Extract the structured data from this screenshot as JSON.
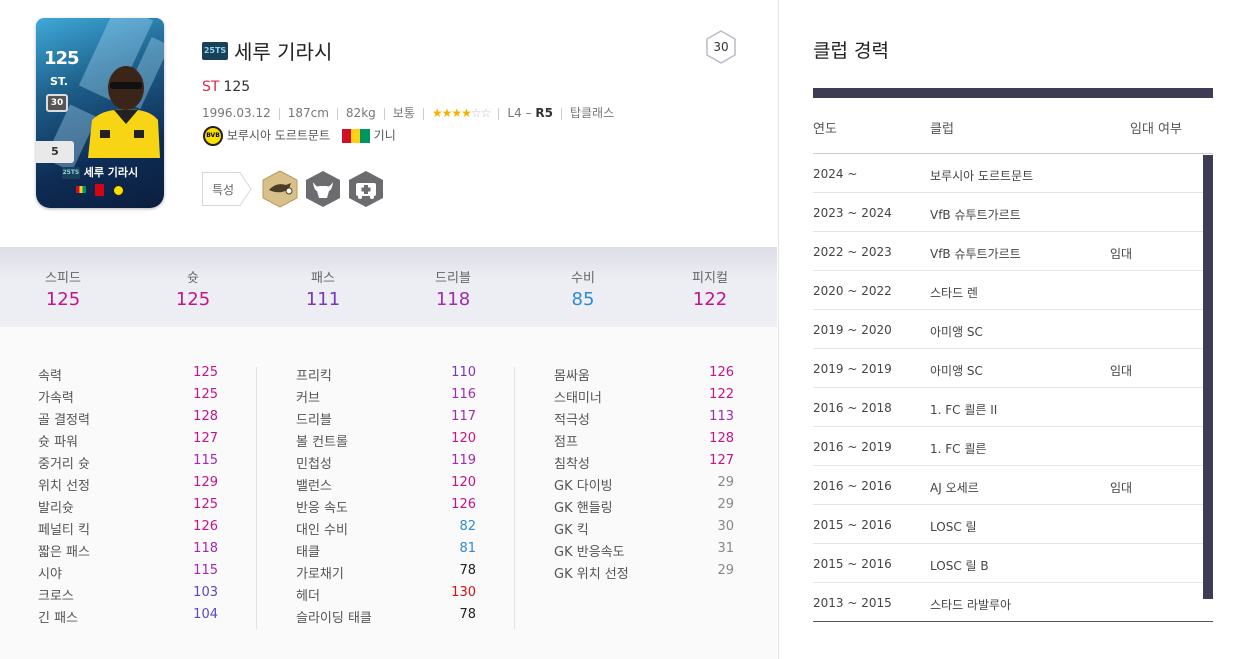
{
  "card": {
    "ovr": "125",
    "position": "ST.",
    "badge": "30",
    "grade": "5",
    "name": "세루 기라시",
    "season_logo": "25TS"
  },
  "player": {
    "season_logo": "25TS",
    "name": "세루 기라시",
    "position": "ST",
    "ovr": "125",
    "salary": "30",
    "birth": "1996.03.12",
    "height": "187cm",
    "weight": "82kg",
    "body_type": "보통",
    "skill_stars_filled": "★★★★",
    "skill_stars_empty": "☆☆",
    "foot_prefix": "L4 – ",
    "foot_r": "R5",
    "tier": "탑클래스",
    "club_logo": "BVB",
    "club": "보루시아 도르트문트",
    "nation": "기니",
    "traits_label": "특성"
  },
  "summary": [
    {
      "label": "스피드",
      "value": "125"
    },
    {
      "label": "슛",
      "value": "125"
    },
    {
      "label": "패스",
      "value": "111"
    },
    {
      "label": "드리블",
      "value": "118"
    },
    {
      "label": "수비",
      "value": "85"
    },
    {
      "label": "피지컬",
      "value": "122"
    }
  ],
  "stats_col1": [
    {
      "name": "속력",
      "value": "125"
    },
    {
      "name": "가속력",
      "value": "125"
    },
    {
      "name": "골 결정력",
      "value": "128"
    },
    {
      "name": "슛 파워",
      "value": "127"
    },
    {
      "name": "중거리 슛",
      "value": "115"
    },
    {
      "name": "위치 선정",
      "value": "129"
    },
    {
      "name": "발리슛",
      "value": "125"
    },
    {
      "name": "페널티 킥",
      "value": "126"
    },
    {
      "name": "짧은 패스",
      "value": "118"
    },
    {
      "name": "시야",
      "value": "115"
    },
    {
      "name": "크로스",
      "value": "103"
    },
    {
      "name": "긴 패스",
      "value": "104"
    }
  ],
  "stats_col2": [
    {
      "name": "프리킥",
      "value": "110"
    },
    {
      "name": "커브",
      "value": "116"
    },
    {
      "name": "드리블",
      "value": "117"
    },
    {
      "name": "볼 컨트롤",
      "value": "120"
    },
    {
      "name": "민첩성",
      "value": "119"
    },
    {
      "name": "밸런스",
      "value": "120"
    },
    {
      "name": "반응 속도",
      "value": "126"
    },
    {
      "name": "대인 수비",
      "value": "82"
    },
    {
      "name": "태클",
      "value": "81"
    },
    {
      "name": "가로채기",
      "value": "78"
    },
    {
      "name": "헤더",
      "value": "130"
    },
    {
      "name": "슬라이딩 태클",
      "value": "78"
    }
  ],
  "stats_col3": [
    {
      "name": "몸싸움",
      "value": "126"
    },
    {
      "name": "스태미너",
      "value": "122"
    },
    {
      "name": "적극성",
      "value": "113"
    },
    {
      "name": "점프",
      "value": "128"
    },
    {
      "name": "침착성",
      "value": "127"
    },
    {
      "name": "GK 다이빙",
      "value": "29"
    },
    {
      "name": "GK 핸들링",
      "value": "29"
    },
    {
      "name": "GK 킥",
      "value": "30"
    },
    {
      "name": "GK 반응속도",
      "value": "31"
    },
    {
      "name": "GK 위치 선정",
      "value": "29"
    }
  ],
  "career": {
    "title": "클럽 경력",
    "headers": {
      "year": "연도",
      "club": "클럽",
      "loan": "임대 여부"
    },
    "rows": [
      {
        "year": "2024 ~",
        "club": "보루시아 도르트문트",
        "loan": ""
      },
      {
        "year": "2023 ~ 2024",
        "club": "VfB 슈투트가르트",
        "loan": ""
      },
      {
        "year": "2022 ~ 2023",
        "club": "VfB 슈투트가르트",
        "loan": "임대"
      },
      {
        "year": "2020 ~ 2022",
        "club": "스타드 렌",
        "loan": ""
      },
      {
        "year": "2019 ~ 2020",
        "club": "아미앵 SC",
        "loan": ""
      },
      {
        "year": "2019 ~ 2019",
        "club": "아미앵 SC",
        "loan": "임대"
      },
      {
        "year": "2016 ~ 2018",
        "club": "1. FC 쾰른 II",
        "loan": ""
      },
      {
        "year": "2016 ~ 2019",
        "club": "1. FC 쾰른",
        "loan": ""
      },
      {
        "year": "2016 ~ 2016",
        "club": "AJ 오세르",
        "loan": "임대"
      },
      {
        "year": "2015 ~ 2016",
        "club": "LOSC 릴",
        "loan": ""
      },
      {
        "year": "2015 ~ 2016",
        "club": "LOSC 릴 B",
        "loan": ""
      },
      {
        "year": "2013 ~ 2015",
        "club": "스타드 라발루아",
        "loan": ""
      }
    ]
  },
  "colors": {
    "pink": "#c4148a",
    "blue": "#2f8bd0",
    "red": "#d40f1a",
    "position": "#e0264c",
    "table_bar": "#3e3b55"
  }
}
